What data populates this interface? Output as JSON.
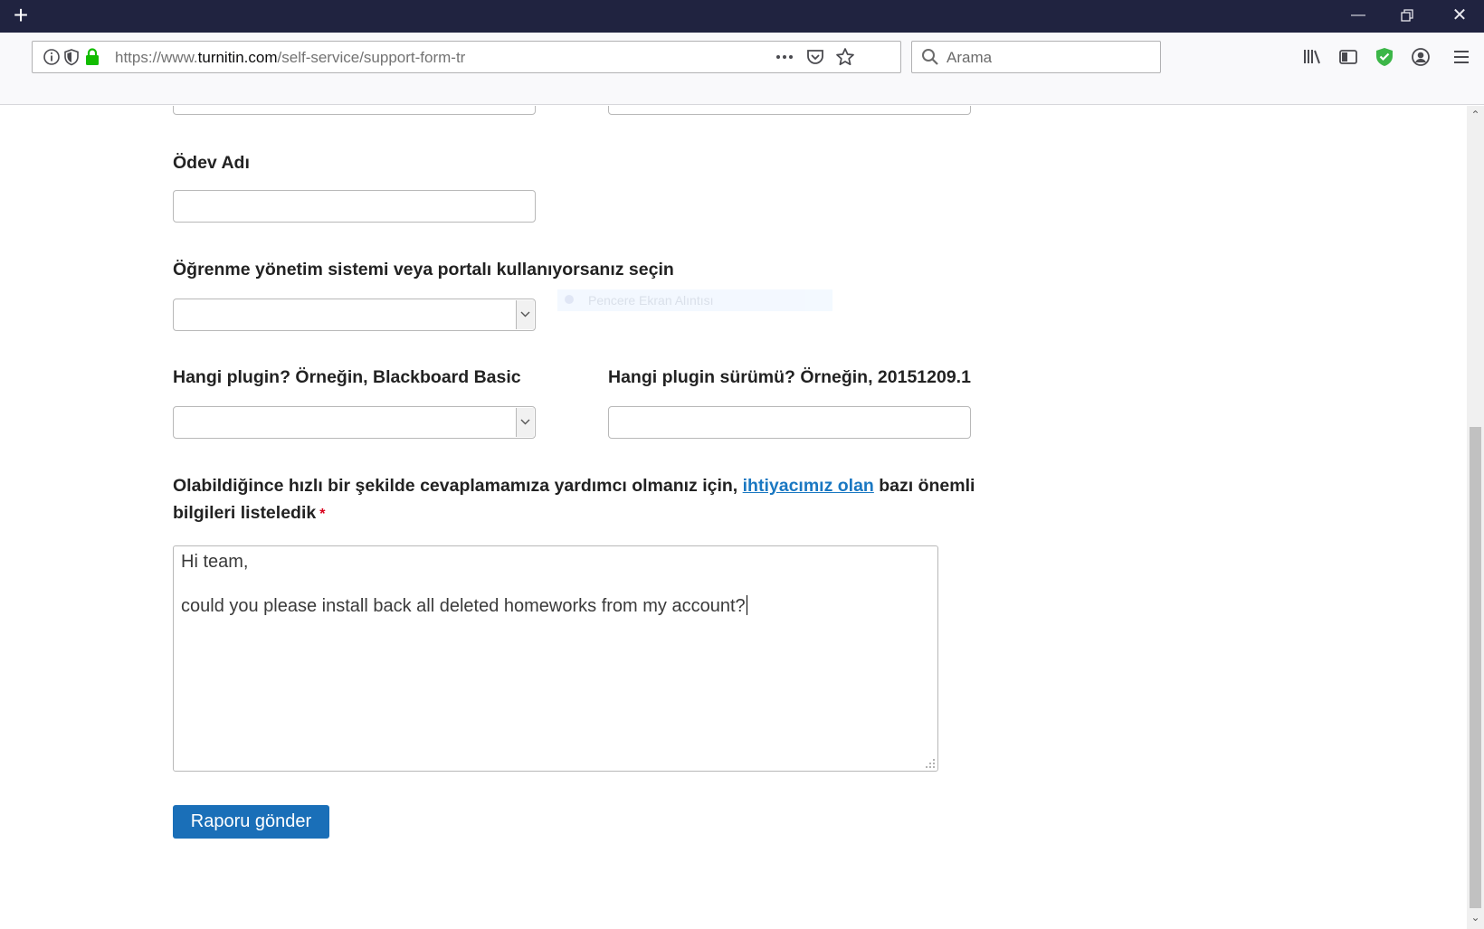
{
  "browser": {
    "url_prefix": "https://www.",
    "url_domain": "turnitin.com",
    "url_path": "/self-service/support-form-tr",
    "search_placeholder": "Arama"
  },
  "form": {
    "assignment_label": "Ödev Adı",
    "lms_label": "Öğrenme yönetim sistemi veya portalı kullanıyorsanız seçin",
    "plugin_label": "Hangi plugin? Örneğin, Blackboard Basic",
    "plugin_version_label": "Hangi plugin sürümü? Örneğin, 20151209.1",
    "details_text_before": "Olabildiğince hızlı bir şekilde cevaplamamıza yardımcı olmanız için, ",
    "details_link": "ihtiyacımız olan",
    "details_text_after": " bazı önemli bilgileri listeledik",
    "required_mark": "*",
    "message_line1": "Hi team,",
    "message_line2": "could you please install back all deleted homeworks from my account?",
    "submit_label": "Raporu gönder"
  },
  "overlay": {
    "tooltip_text": "Pencere Ekran Alıntısı"
  }
}
